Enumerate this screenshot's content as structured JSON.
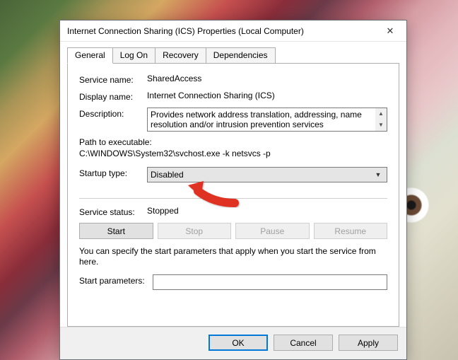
{
  "window": {
    "title": "Internet Connection Sharing (ICS) Properties (Local Computer)"
  },
  "tabs": [
    {
      "label": "General",
      "active": true
    },
    {
      "label": "Log On",
      "active": false
    },
    {
      "label": "Recovery",
      "active": false
    },
    {
      "label": "Dependencies",
      "active": false
    }
  ],
  "general": {
    "service_name_label": "Service name:",
    "service_name_value": "SharedAccess",
    "display_name_label": "Display name:",
    "display_name_value": "Internet Connection Sharing (ICS)",
    "description_label": "Description:",
    "description_value": "Provides network address translation, addressing, name resolution and/or intrusion prevention services",
    "path_label": "Path to executable:",
    "path_value": "C:\\WINDOWS\\System32\\svchost.exe -k netsvcs -p",
    "startup_type_label": "Startup type:",
    "startup_type_value": "Disabled",
    "status_label": "Service status:",
    "status_value": "Stopped",
    "btn_start": "Start",
    "btn_stop": "Stop",
    "btn_pause": "Pause",
    "btn_resume": "Resume",
    "help_text": "You can specify the start parameters that apply when you start the service from here.",
    "start_params_label": "Start parameters:",
    "start_params_value": ""
  },
  "buttons": {
    "ok": "OK",
    "cancel": "Cancel",
    "apply": "Apply"
  }
}
